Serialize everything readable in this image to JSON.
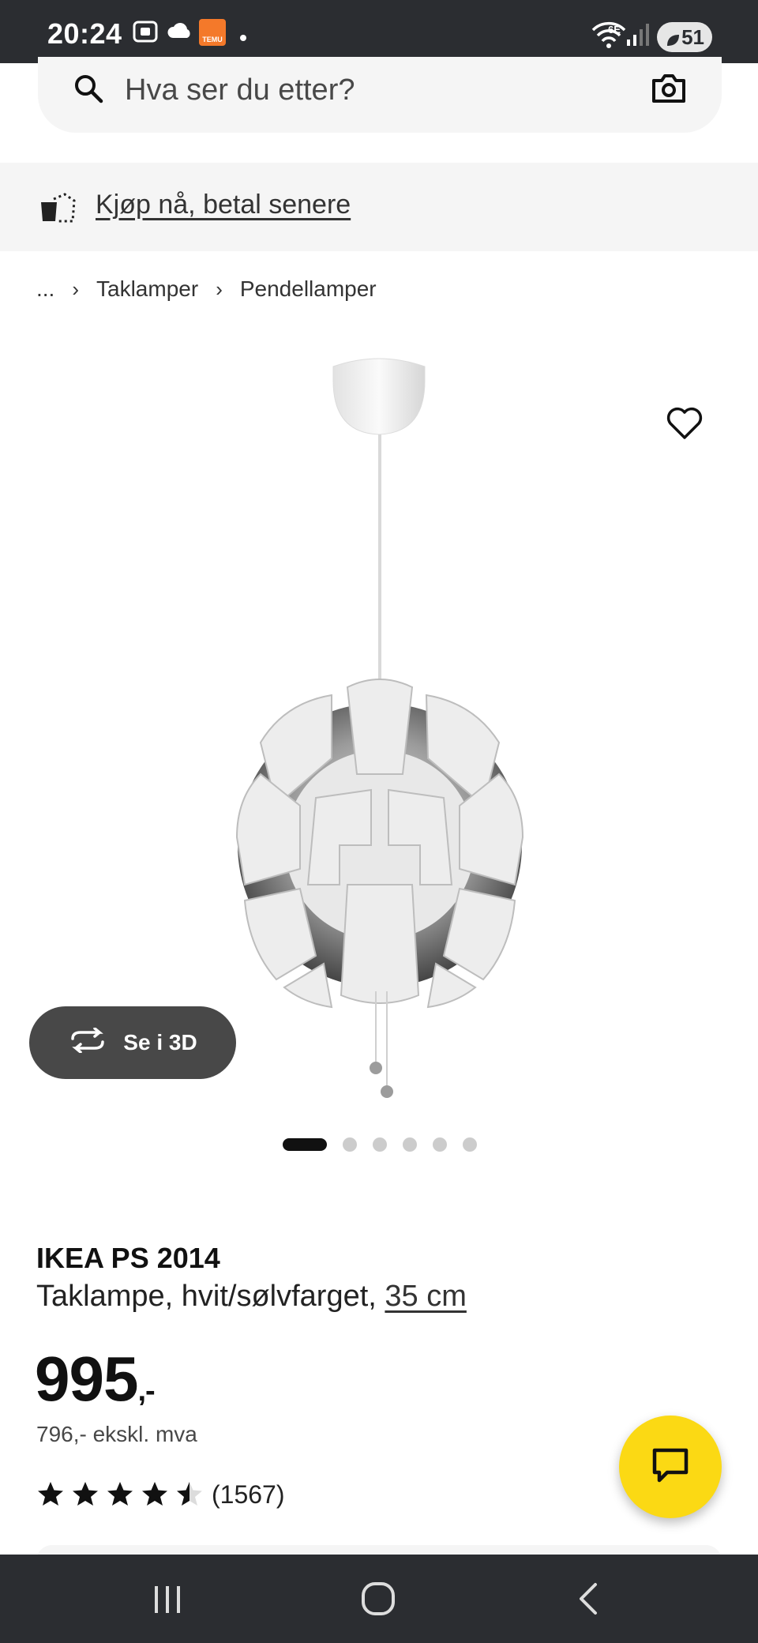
{
  "status_bar": {
    "time": "20:24",
    "temu_badge": "TEMU",
    "network": "6E",
    "battery": "51"
  },
  "search": {
    "placeholder": "Hva ser du etter?"
  },
  "banner": {
    "text": "Kjøp nå, betal senere"
  },
  "breadcrumb": {
    "ellipsis": "...",
    "items": [
      "Taklamper",
      "Pendellamper"
    ]
  },
  "gallery": {
    "view_3d_label": "Se i 3D",
    "dots_total": 6,
    "active_dot": 1
  },
  "product": {
    "name": "IKEA PS 2014",
    "description": "Taklampe, hvit/sølvfarget,",
    "size": "35 cm",
    "price": "995",
    "price_suffix": ",-",
    "price_ex_vat": "796,- ekskl. mva",
    "rating": 4.5,
    "review_count": "(1567)"
  },
  "colors": {
    "status_bar_bg": "#2b2d31",
    "accent_yellow": "#fbd914",
    "button_dark": "#484848"
  }
}
